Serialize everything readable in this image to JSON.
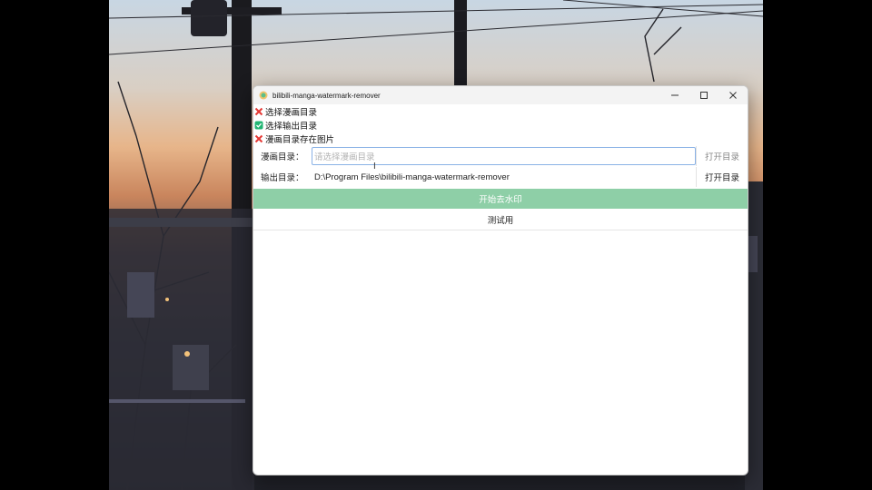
{
  "window": {
    "title": "bilibili-manga-watermark-remover",
    "controls": {
      "minimize": "—",
      "maximize": "☐",
      "close": "✕"
    }
  },
  "status": [
    {
      "label": "选择漫画目录",
      "state": "error",
      "icon": "red-x-icon"
    },
    {
      "label": "选择输出目录",
      "state": "ok",
      "icon": "green-check-icon"
    },
    {
      "label": "漫画目录存在图片",
      "state": "error",
      "icon": "red-x-icon"
    }
  ],
  "manga_dir": {
    "label": "漫画目录：",
    "value": "",
    "placeholder": "请选择漫画目录",
    "open_label": "打开目录"
  },
  "output_dir": {
    "label": "输出目录：",
    "value": "D:\\Program Files\\bilibili-manga-watermark-remover",
    "open_label": "打开目录"
  },
  "actions": {
    "start_label": "开始去水印",
    "test_label": "测试用"
  },
  "colors": {
    "start_button": "#8ecfa7",
    "error": "#e53935",
    "ok": "#22b573"
  }
}
